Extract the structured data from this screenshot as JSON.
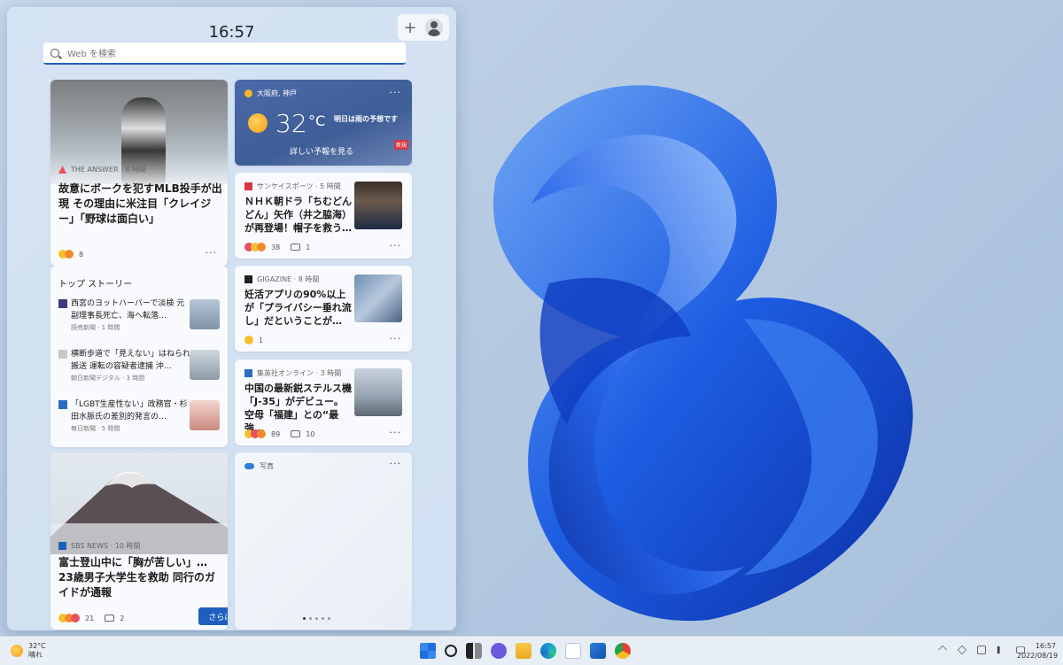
{
  "panel": {
    "clock": "16:57",
    "add_label": "+",
    "search_placeholder": "Web を検索"
  },
  "card_baseball": {
    "source": "THE ANSWER · 8 時間",
    "headline": "故意にボークを犯すMLB投手が出現 その理由に米注目「クレイジー」「野球は面白い」",
    "reactions": "8",
    "more": "···"
  },
  "weather": {
    "location": "大阪府, 神戸",
    "temp": "32",
    "unit": "°C",
    "forecast": "明日は雨の予想です",
    "detail_link": "詳しい予報を見る",
    "badge": "新規",
    "more": "···"
  },
  "card_sankei": {
    "source": "サンケイスポーツ · 5 時間",
    "headline": "ＮＨＫ朝ドラ「ちむどんどん」矢作（井之脇海）が再登場！帽子を救う…",
    "reactions": "38",
    "comments": "1",
    "more": "···"
  },
  "card_gigazine": {
    "source": "GIGAZINE · 8 時間",
    "headline": "妊活アプリの90%以上が「プライバシー垂れ流し」だということが…",
    "reactions": "1",
    "more": "···"
  },
  "card_shueisha": {
    "source": "集英社オンライン · 3 時間",
    "headline": "中国の最新鋭ステルス機「J-35」がデビュー。空母「福建」との“最強…",
    "reactions": "89",
    "comments": "10",
    "more": "···"
  },
  "top_stories": {
    "title": "トップ ストーリー",
    "items": [
      {
        "text": "西宮のヨットハーバーで淡検 元副理事長死亡、海へ転落…",
        "meta": "読売新聞 · 1 時間"
      },
      {
        "text": "横断歩道で「見えない」はねられ 搬送 運転の容疑者逮捕 沖…",
        "meta": "朝日新聞デジタル · 3 時間"
      },
      {
        "text": "「LGBT生産性ない」政務官・杉田水脈氏の差別的発言の…",
        "meta": "毎日新聞 · 5 時間"
      }
    ]
  },
  "card_fuji": {
    "source": "SBS NEWS · 10 時間",
    "headline": "富士登山中に「胸が苦しい」… 23歳男子大学生を救助 同行のガイドが通報",
    "reactions": "21",
    "comments": "2",
    "more_button": "さらに表示  ›"
  },
  "card_photos": {
    "source": "写真",
    "more": "···"
  },
  "taskbar": {
    "weather_temp": "32°C",
    "weather_desc": "晴れ",
    "time": "16:57",
    "date": "2022/08/19",
    "icons": [
      "start-icon",
      "search-icon",
      "task-view-icon",
      "chat-icon",
      "explorer-icon",
      "edge-icon",
      "snipping-icon",
      "store-icon",
      "chrome-icon"
    ]
  },
  "colors": {
    "accent": "#1f5fbf",
    "weather_card": "#4a6aa8",
    "wallpaper_blue": "#1c5de0"
  }
}
